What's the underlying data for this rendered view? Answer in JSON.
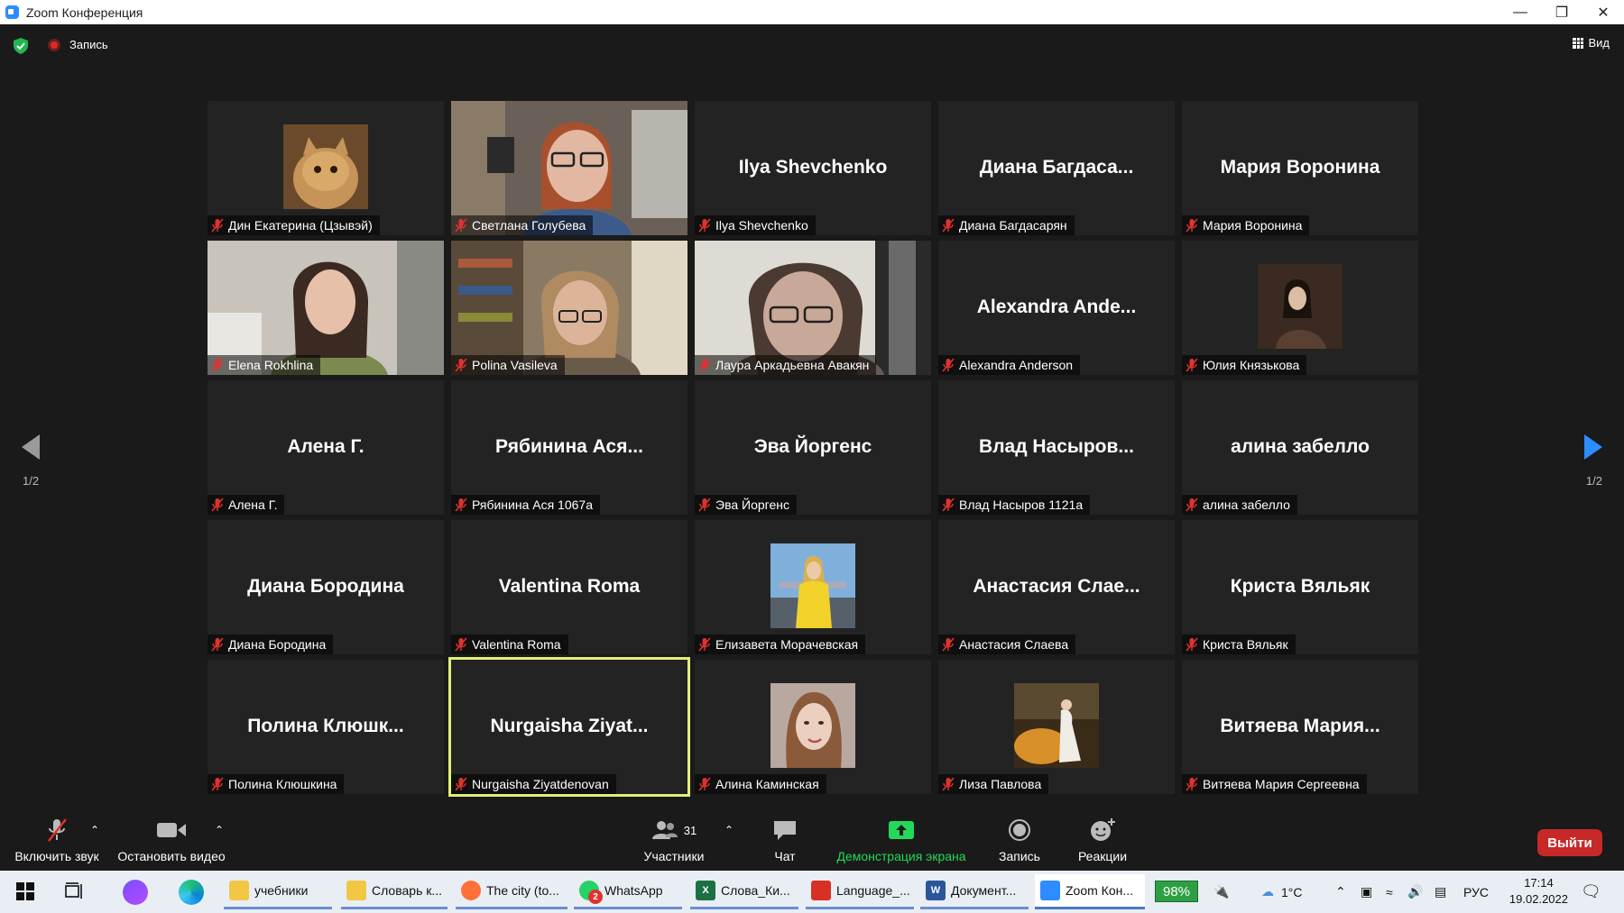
{
  "window": {
    "title": "Zoom Конференция"
  },
  "topbar": {
    "recording_label": "Запись",
    "view_label": "Вид"
  },
  "pagination": {
    "left": "1/2",
    "right": "1/2"
  },
  "tiles": [
    {
      "name": "Дин Екатерина (Цзывэй)",
      "display": "",
      "kind": "avatar",
      "avatar": "cat"
    },
    {
      "name": "Светлана Голубева",
      "display": "",
      "kind": "video",
      "avatar": "woman-glasses-red"
    },
    {
      "name": "Ilya Shevchenko",
      "display": "Ilya Shevchenko",
      "kind": "text"
    },
    {
      "name": "Диана Багдасарян",
      "display": "Диана  Багдаса...",
      "kind": "text"
    },
    {
      "name": "Мария Воронина",
      "display": "Мария Воронина",
      "kind": "text"
    },
    {
      "name": "Elena Rokhlina",
      "display": "",
      "kind": "video",
      "avatar": "woman-dark-hair"
    },
    {
      "name": "Polina Vasileva",
      "display": "",
      "kind": "video",
      "avatar": "woman-books"
    },
    {
      "name": "Лаура Аркадьевна Авакян",
      "display": "",
      "kind": "video",
      "avatar": "woman-glasses-window"
    },
    {
      "name": "Alexandra Anderson",
      "display": "Alexandra  Ande...",
      "kind": "text"
    },
    {
      "name": "Юлия Князькова",
      "display": "",
      "kind": "avatar",
      "avatar": "woman-portrait"
    },
    {
      "name": "Алена Г.",
      "display": "Алена Г.",
      "kind": "text"
    },
    {
      "name": "Рябинина Ася 1067а",
      "display": "Рябинина  Ася...",
      "kind": "text"
    },
    {
      "name": "Эва Йоргенс",
      "display": "Эва Йоргенс",
      "kind": "text"
    },
    {
      "name": "Влад Насыров 1121а",
      "display": "Влад  Насыров...",
      "kind": "text"
    },
    {
      "name": "алина забелло",
      "display": "алина забелло",
      "kind": "text"
    },
    {
      "name": "Диана Бородина",
      "display": "Диана Бородина",
      "kind": "text"
    },
    {
      "name": "Valentina Roma",
      "display": "Valentina Roma",
      "kind": "text"
    },
    {
      "name": "Елизавета Морачевская",
      "display": "",
      "kind": "avatar",
      "avatar": "woman-yellow"
    },
    {
      "name": "Анастасия Слаева",
      "display": "Анастасия  Слае...",
      "kind": "text"
    },
    {
      "name": "Криста Вяльяк",
      "display": "Криста Вяльяк",
      "kind": "text"
    },
    {
      "name": "Полина Клюшкина",
      "display": "Полина  Клюшк...",
      "kind": "text"
    },
    {
      "name": "Nurgaisha Ziyatdenovan",
      "display": "Nurgaisha  Ziyat...",
      "kind": "text",
      "active": true
    },
    {
      "name": "Алина Каминская",
      "display": "",
      "kind": "avatar",
      "avatar": "woman-face"
    },
    {
      "name": "Лиза Павлова",
      "display": "",
      "kind": "avatar",
      "avatar": "painting"
    },
    {
      "name": "Витяева Мария Сергеевна",
      "display": "Витяева  Мария...",
      "kind": "text"
    }
  ],
  "toolbar": {
    "unmute": "Включить звук",
    "stop_video": "Остановить видео",
    "participants": "Участники",
    "participants_count": "31",
    "chat": "Чат",
    "share": "Демонстрация экрана",
    "record": "Запись",
    "reactions": "Реакции",
    "leave": "Выйти"
  },
  "taskbar": {
    "items": [
      {
        "label": "учебники",
        "icon": "folder-icon",
        "color": "#f2c744"
      },
      {
        "label": "Словарь к...",
        "icon": "folder-icon",
        "color": "#f2c744"
      },
      {
        "label": "The city (to...",
        "icon": "firefox-icon",
        "color": "#ff7139"
      },
      {
        "label": "WhatsApp",
        "icon": "whatsapp-icon",
        "color": "#25d366",
        "badge": "2"
      },
      {
        "label": "Слова_Ки...",
        "icon": "excel-icon",
        "color": "#1d7044"
      },
      {
        "label": "Language_...",
        "icon": "pdf-icon",
        "color": "#d93025"
      },
      {
        "label": "Документ...",
        "icon": "word-icon",
        "color": "#2b579a"
      },
      {
        "label": "Zoom Кон...",
        "icon": "zoom-icon",
        "color": "#2d8cff"
      }
    ],
    "battery": "98%",
    "temperature": "1°C",
    "language": "РУС",
    "time": "17:14",
    "date": "19.02.2022"
  },
  "colors": {
    "accent": "#2d8cff",
    "share_green": "#23d959",
    "leave_red": "#c72828",
    "active_border": "#e3ee7a",
    "mic_off": "#e0322f"
  }
}
